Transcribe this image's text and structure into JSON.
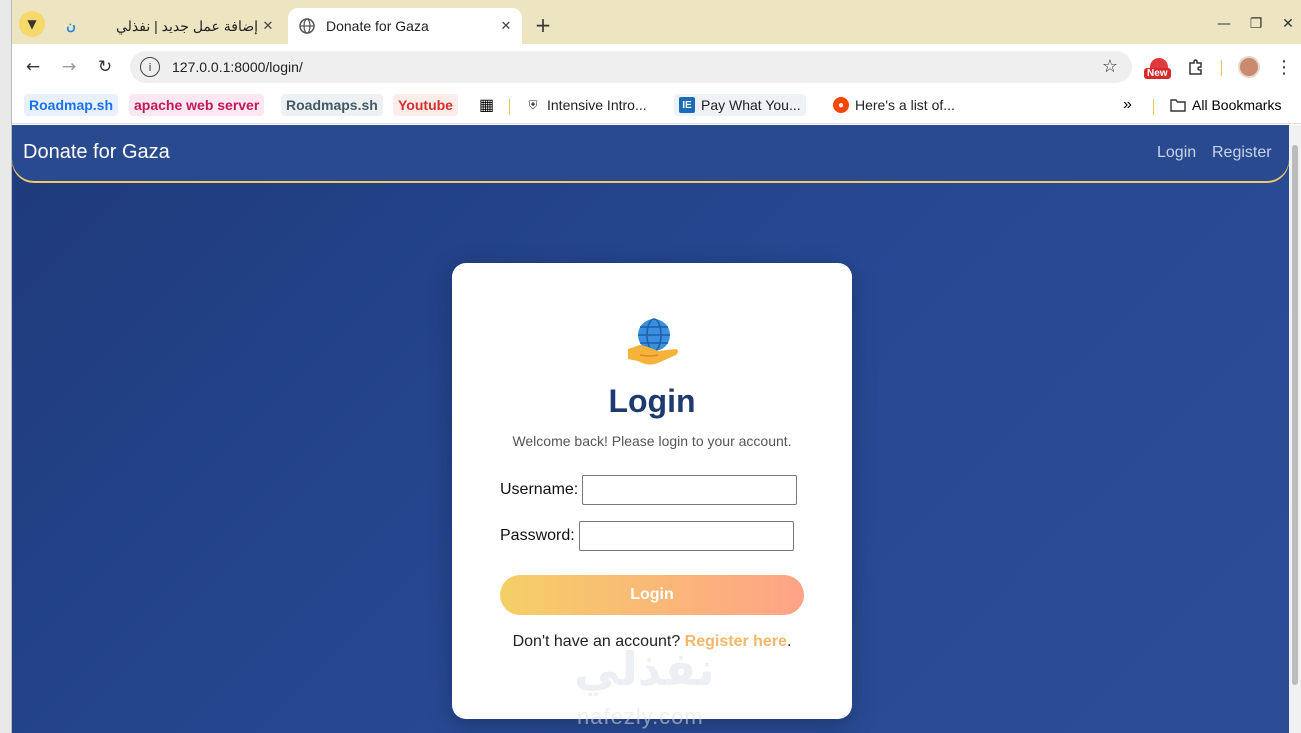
{
  "tabs": [
    {
      "title": "إضافة عمل جديد | نفذلي",
      "favicon": "nafezly-icon",
      "active": false
    },
    {
      "title": "Donate for Gaza",
      "favicon": "globe-icon",
      "active": true
    }
  ],
  "toolbar": {
    "url": "127.0.0.1:8000/login/",
    "new_badge": "New"
  },
  "bookmarks": [
    {
      "label": "Roadmap.sh",
      "color": "#1a73e8",
      "bg": "#e8f0fe"
    },
    {
      "label": "apache web server",
      "color": "#c2185b",
      "bg": "#fde7f1"
    },
    {
      "label": "Roadmaps.sh",
      "color": "#455a64",
      "bg": "#eef1f3"
    },
    {
      "label": "Youtube",
      "color": "#d32f2f",
      "bg": "#fdecea"
    },
    {
      "label": "Intensive Intro...",
      "color": "#222222"
    },
    {
      "label": "Pay What You...",
      "color": "#222222"
    },
    {
      "label": "Here's a list of...",
      "color": "#222222"
    }
  ],
  "all_bookmarks": "All Bookmarks",
  "page": {
    "brand": "Donate for Gaza",
    "nav": {
      "login": "Login",
      "register": "Register"
    },
    "card": {
      "title": "Login",
      "subtitle": "Welcome back! Please login to your account.",
      "username_label": "Username:",
      "password_label": "Password:",
      "username_value": "",
      "password_value": "",
      "button": "Login",
      "register_prompt": "Don't have an account?",
      "register_link": "Register here",
      "register_suffix": "."
    }
  },
  "watermark": {
    "arabic": "نفذلي",
    "latin": "nafezly.com"
  },
  "colors": {
    "accent": "#f4b76b",
    "title": "#1e3a6e",
    "navbar": "#2a4a8f"
  }
}
